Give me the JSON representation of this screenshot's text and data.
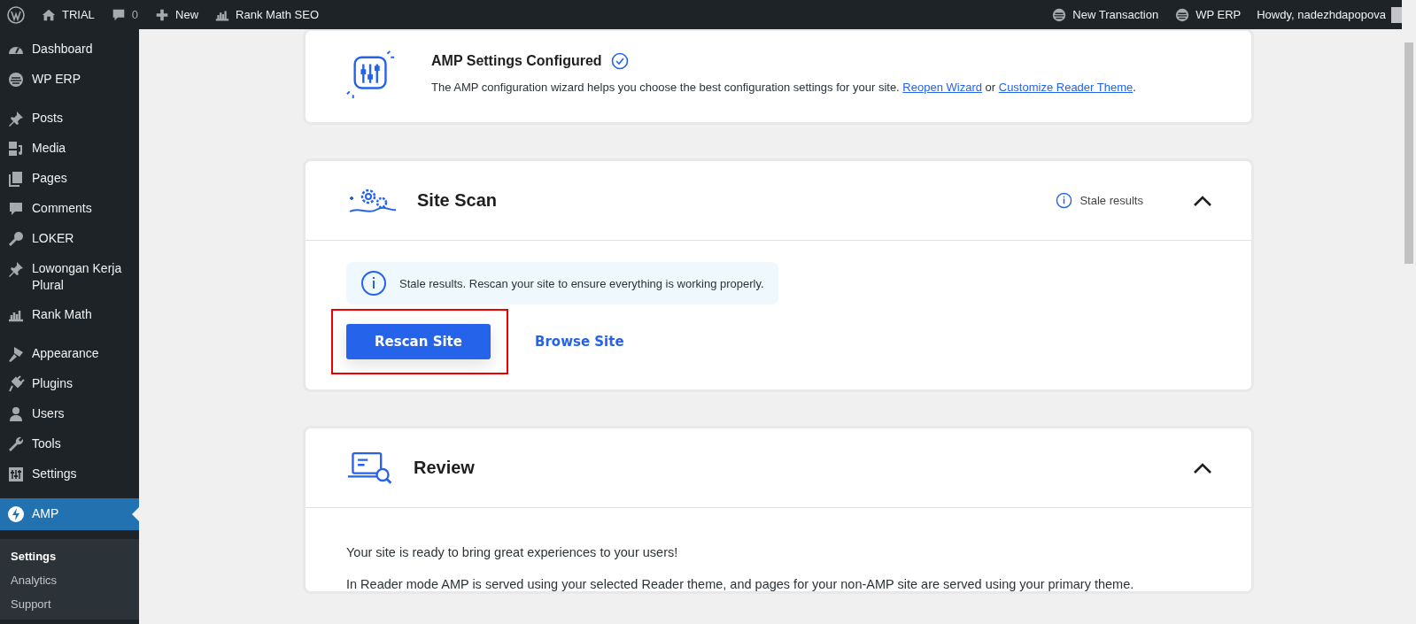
{
  "admin_bar": {
    "left": [
      {
        "kind": "wp-logo"
      },
      {
        "kind": "home",
        "label": "TRIAL"
      },
      {
        "kind": "comments",
        "label": "0"
      },
      {
        "kind": "plus",
        "label": "New"
      },
      {
        "kind": "chart",
        "label": "Rank Math SEO"
      }
    ],
    "right": [
      {
        "kind": "erp",
        "label": "New Transaction"
      },
      {
        "kind": "erp",
        "label": "WP ERP"
      },
      {
        "kind": "user",
        "label": "Howdy, nadezhdapopova"
      }
    ]
  },
  "sidebar": {
    "groups": [
      {
        "items": [
          {
            "kind": "gauge",
            "label": "Dashboard",
            "selected": false
          },
          {
            "kind": "erp",
            "label": "WP ERP",
            "selected": false
          }
        ]
      },
      {
        "items": [
          {
            "kind": "pin",
            "label": "Posts",
            "selected": false
          },
          {
            "kind": "media",
            "label": "Media",
            "selected": false
          },
          {
            "kind": "pages",
            "label": "Pages",
            "selected": false
          },
          {
            "kind": "bubble",
            "label": "Comments",
            "selected": false
          },
          {
            "kind": "key",
            "label": "LOKER",
            "selected": false
          },
          {
            "kind": "pin",
            "label": "Lowongan Kerja Plural",
            "selected": false
          },
          {
            "kind": "chart",
            "label": "Rank Math",
            "selected": false
          }
        ]
      },
      {
        "items": [
          {
            "kind": "brush",
            "label": "Appearance",
            "selected": false
          },
          {
            "kind": "plug",
            "label": "Plugins",
            "selected": false
          },
          {
            "kind": "person",
            "label": "Users",
            "selected": false
          },
          {
            "kind": "wrench",
            "label": "Tools",
            "selected": false
          },
          {
            "kind": "sliders",
            "label": "Settings",
            "selected": false
          }
        ]
      },
      {
        "items": [
          {
            "kind": "bolt",
            "label": "AMP",
            "selected": true
          }
        ]
      }
    ],
    "submenu": [
      {
        "label": "Settings",
        "selected": true
      },
      {
        "label": "Analytics",
        "selected": false
      },
      {
        "label": "Support",
        "selected": false
      }
    ]
  },
  "configured_card": {
    "title": "AMP Settings Configured",
    "text": "The AMP configuration wizard helps you choose the best configuration settings for your site.",
    "link_1": "Reopen Wizard",
    "joiner": "or",
    "link_2": "Customize Reader Theme",
    "end": "."
  },
  "site_scan": {
    "title": "Site Scan",
    "status": "Stale results",
    "expanded": true,
    "notice": "Stale results. Rescan your site to ensure everything is working properly.",
    "buttons": [
      {
        "kind": "primary",
        "label": "Rescan Site",
        "highlighted": true
      },
      {
        "kind": "link",
        "label": "Browse Site",
        "highlighted": false
      }
    ]
  },
  "review": {
    "title": "Review",
    "expanded": true,
    "paragraphs": [
      "Your site is ready to bring great experiences to your users!",
      "In Reader mode AMP is served using your selected Reader theme, and pages for your non-AMP site are served using your primary theme."
    ]
  }
}
